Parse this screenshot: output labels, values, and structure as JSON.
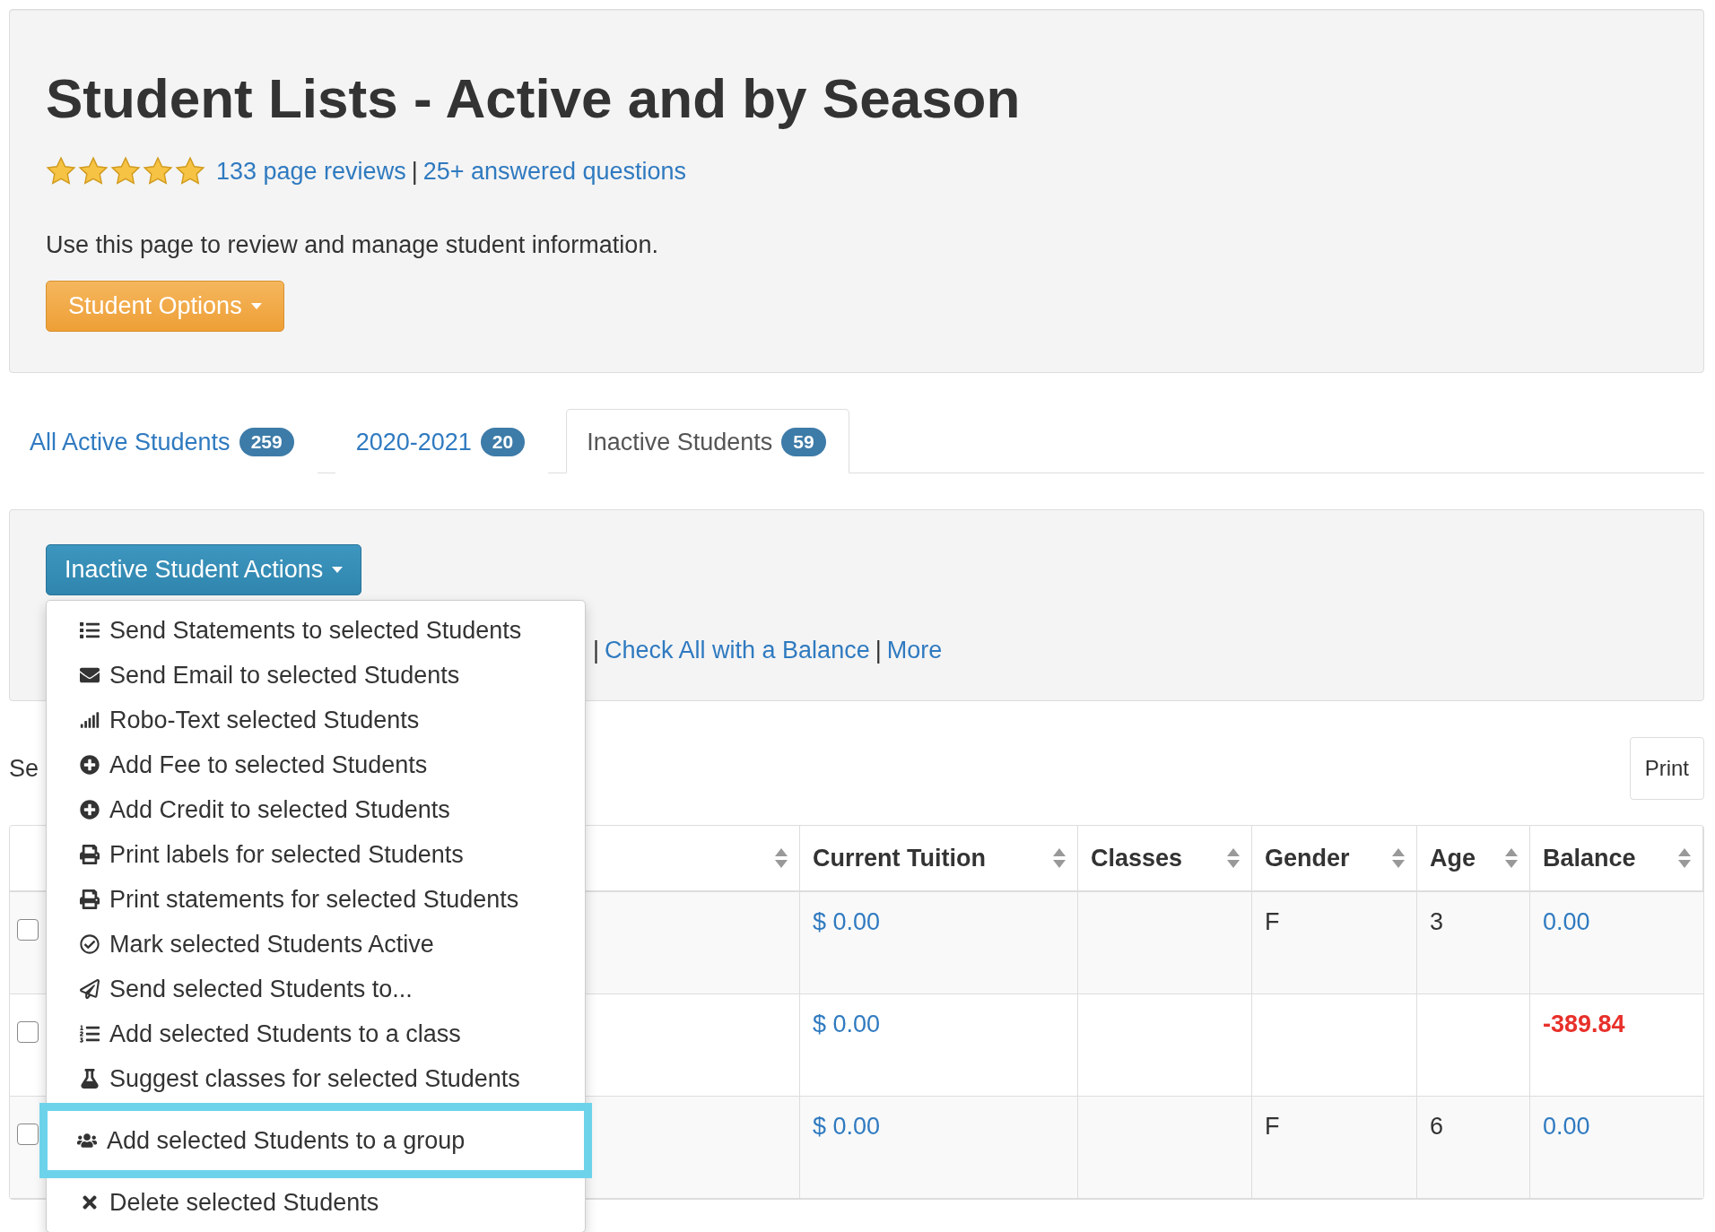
{
  "header": {
    "title": "Student Lists - Active and by Season",
    "stars": 5,
    "reviews_link": "133 page reviews",
    "separator": "|",
    "questions_link": "25+ answered questions",
    "description": "Use this page to review and manage student information.",
    "options_button": "Student Options"
  },
  "tabs": [
    {
      "label": "All Active Students",
      "count": "259",
      "selected": false
    },
    {
      "label": "2020-2021",
      "count": "20",
      "selected": false
    },
    {
      "label": "Inactive Students",
      "count": "59",
      "selected": true
    }
  ],
  "actions": {
    "button": "Inactive Student Actions",
    "menu": [
      {
        "kind": "list",
        "label": "Send Statements to selected Students",
        "selected": false
      },
      {
        "kind": "email",
        "label": "Send Email to selected Students",
        "selected": false
      },
      {
        "kind": "signal",
        "label": "Robo-Text selected Students",
        "selected": false
      },
      {
        "kind": "add",
        "label": "Add Fee to selected Students",
        "selected": false
      },
      {
        "kind": "add",
        "label": "Add Credit to selected Students",
        "selected": false
      },
      {
        "kind": "print",
        "label": "Print labels for selected Students",
        "selected": false
      },
      {
        "kind": "print",
        "label": "Print statements for selected Students",
        "selected": false
      },
      {
        "kind": "check",
        "label": "Mark selected Students Active",
        "selected": false
      },
      {
        "kind": "send",
        "label": "Send selected Students to...",
        "selected": false
      },
      {
        "kind": "class",
        "label": "Add selected Students to a class",
        "selected": false
      },
      {
        "kind": "suggest",
        "label": "Suggest classes for selected Students",
        "selected": false
      },
      {
        "kind": "group",
        "label": "Add selected Students to a group",
        "selected": true
      },
      {
        "kind": "delete",
        "label": "Delete selected Students",
        "selected": false
      }
    ],
    "links": [
      {
        "kind": "separator",
        "text": "|"
      },
      {
        "kind": "link",
        "text": "Check All with a Balance"
      },
      {
        "kind": "separator",
        "text": "|"
      },
      {
        "kind": "link",
        "text": "More"
      }
    ]
  },
  "search": {
    "label": "Se"
  },
  "print_button": "Print",
  "table": {
    "columns": [
      {
        "kind": "blank"
      },
      {
        "kind": "sort"
      },
      {
        "kind": "sort",
        "label": "Current Tuition"
      },
      {
        "kind": "sort",
        "label": "Classes"
      },
      {
        "kind": "sort",
        "label": "Gender"
      },
      {
        "kind": "sort",
        "label": "Age"
      },
      {
        "kind": "sort",
        "label": "Balance"
      }
    ],
    "rows": [
      {
        "checked": false,
        "tuition": "$ 0.00",
        "gender": "F",
        "age": "3",
        "balance": "0.00",
        "negative": false
      },
      {
        "checked": false,
        "tuition": "$ 0.00",
        "balance": "-389.84",
        "negative": true
      },
      {
        "checked": false,
        "tuition": "$ 0.00",
        "gender": "F",
        "age": "6",
        "balance": "0.00",
        "negative": false
      }
    ]
  }
}
